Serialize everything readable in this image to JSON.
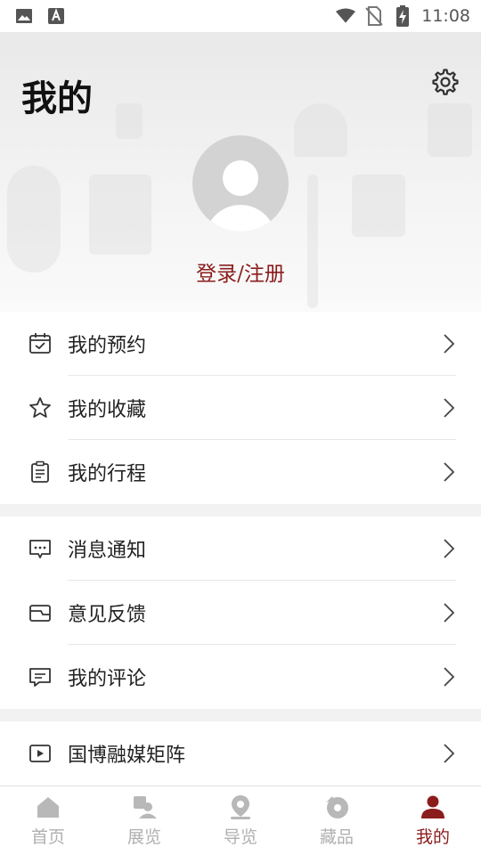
{
  "status_bar": {
    "time": "11:08"
  },
  "header": {
    "title": "我的",
    "login_text": "登录/注册"
  },
  "menu_groups": [
    {
      "items": [
        {
          "label": "我的预约",
          "icon": "calendar-check-icon"
        },
        {
          "label": "我的收藏",
          "icon": "star-icon"
        },
        {
          "label": "我的行程",
          "icon": "clipboard-list-icon"
        }
      ]
    },
    {
      "items": [
        {
          "label": "消息通知",
          "icon": "message-dots-icon"
        },
        {
          "label": "意见反馈",
          "icon": "feedback-box-icon"
        },
        {
          "label": "我的评论",
          "icon": "comment-lines-icon"
        }
      ]
    },
    {
      "items": [
        {
          "label": "国博融媒矩阵",
          "icon": "play-video-icon"
        }
      ]
    }
  ],
  "bottom_nav": {
    "tabs": [
      {
        "label": "首页",
        "icon": "home-icon"
      },
      {
        "label": "展览",
        "icon": "exhibition-icon"
      },
      {
        "label": "导览",
        "icon": "location-pin-icon"
      },
      {
        "label": "藏品",
        "icon": "artifact-icon"
      },
      {
        "label": "我的",
        "icon": "user-icon"
      }
    ],
    "active_index": 4
  },
  "colors": {
    "accent": "#8b1c1c",
    "inactive": "#b0b0b0",
    "background": "#f2f2f2"
  }
}
